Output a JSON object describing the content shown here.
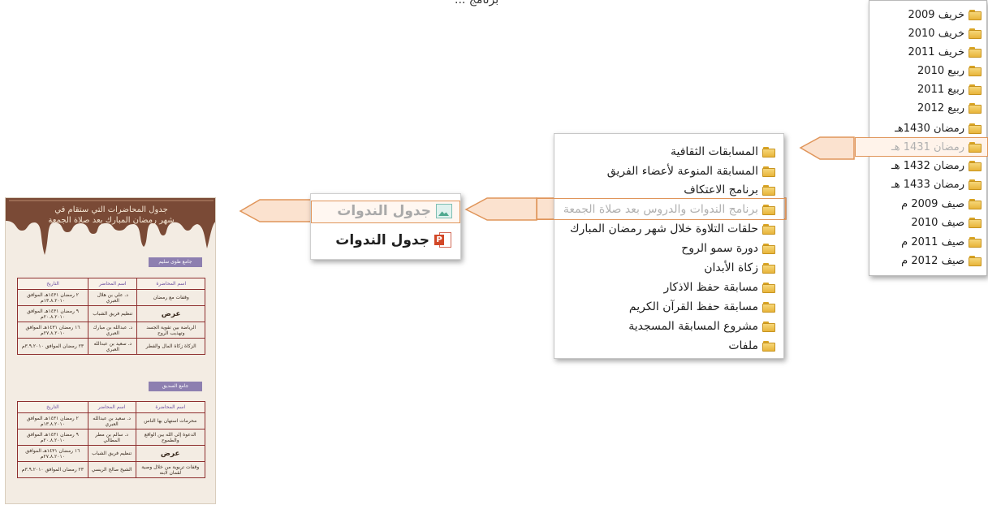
{
  "top_caption": "برنامج ...",
  "seasons_panel": {
    "items": [
      "خريف 2009",
      "خريف 2010",
      "خريف 2011",
      "ربيع 2010",
      "ربيع 2011",
      "ربيع 2012",
      "رمضان 1430هـ",
      "رمضان 1431 هـ",
      "رمضان 1432 هـ",
      "رمضان 1433 هـ",
      "صيف 2009 م",
      "صيف 2010",
      "صيف 2011 م",
      "صيف 2012 م"
    ],
    "selected_index": 7
  },
  "programs_panel": {
    "items": [
      "المسابقات الثقافية",
      "المسابقة المنوعة لأعضاء الفريق",
      "برنامج الاعتكاف",
      "برنامج الندوات والدروس بعد صلاة الجمعة",
      "حلقات التلاوة خلال شهر رمضان المبارك",
      "دورة سمو الروح",
      "زكاة الأبدان",
      "مسابقة حفظ الاذكار",
      "مسابقة حفظ القرآن الكريم",
      "مشروع المسابقة المسجدية",
      "ملفات"
    ],
    "selected_index": 3
  },
  "files_panel": {
    "items": [
      {
        "label": "جدول الندوات",
        "icon": "image-file-icon"
      },
      {
        "label": "جدول الندوات",
        "icon": "powerpoint-file-icon"
      }
    ],
    "selected_index": 0
  },
  "poster": {
    "title_line1": "جدول المحاضرات التي ستقام في",
    "title_line2": "شهر رمضان المبارك بعد صلاة الجمعة",
    "section1": {
      "mosque": "جامع طوى سليم",
      "headers": [
        "اسم المحاضرة",
        "اسم المحاضر",
        "التاريخ"
      ],
      "rows": [
        [
          "وقفات مع رمضان",
          "د. علي بن هلال العبري",
          "٢ رمضان ١٤٣١هـ الموافق ١٣.٨.٢٠١٠م"
        ],
        [
          "عرض",
          "تنظيم فريق الشباب",
          "٩ رمضان ١٤٣١هـ الموافق ٢٠.٨.٢٠١٠م"
        ],
        [
          "الرياضة بين تقوية الجسد وتهذيب الروح",
          "د. عبدالله بن مبارك العبري",
          "١٦ رمضان ١٤٣١هـ الموافق ٢٧.٨.٢٠١٠م"
        ],
        [
          "الزكاة زكاة المال والفطر",
          "د. سعيد بن عبدالله العبري",
          "٢٣ رمضان الموافق ٣.٩.٢٠١٠م"
        ]
      ]
    },
    "section2": {
      "mosque": "جامع السديق",
      "headers": [
        "اسم المحاضرة",
        "اسم المحاضر",
        "التاريخ"
      ],
      "rows": [
        [
          "محرمات استهان بها الناس",
          "د. سعيد بن عبدالله العبري",
          "٢ رمضان ١٤٣١هـ الموافق ١٣.٨.٢٠١٠م"
        ],
        [
          "الدعوة إلى الله بين الواقع والطموح",
          "د. سالم بن مطر المطالي",
          "٩ رمضان ١٤٣١هـ الموافق ٢٠.٨.٢٠١٠م"
        ],
        [
          "عرض",
          "تنظيم فريق الشباب",
          "١٦ رمضان ١٤٣١هـ الموافق ٢٧.٨.٢٠١٠م"
        ],
        [
          "وقفات تربوية من خلال وصية لقمان لابنه",
          "الشيخ صالح الريسي",
          "٢٣ رمضان الموافق ٣.٩.٢٠١٠م"
        ]
      ]
    }
  },
  "colors": {
    "accent_orange": "#e0955a",
    "highlight_fill": "#fbe2cf",
    "folder_yellow": "#e8b43a",
    "poster_drip_brown": "#7a4a36"
  }
}
